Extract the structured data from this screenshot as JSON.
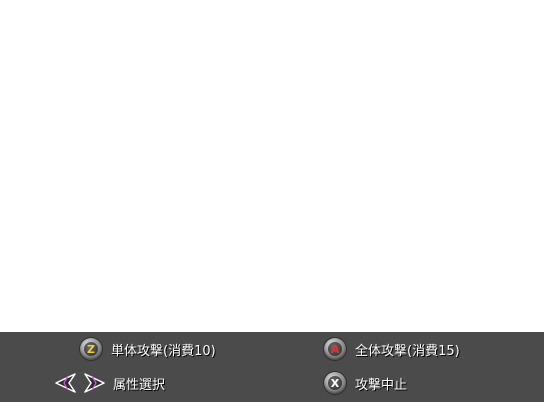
{
  "hints": {
    "single_attack": {
      "key": "Z",
      "key_icon": "z-key-icon",
      "label": "単体攻撃(消費10)",
      "key_color": "#f0c84a"
    },
    "all_attack": {
      "key": "A",
      "key_icon": "a-key-icon",
      "label": "全体攻撃(消費15)",
      "key_color": "#e0342e"
    },
    "attribute_select": {
      "key_icons": [
        "left-arrow-icon",
        "right-arrow-icon"
      ],
      "label": "属性選択",
      "arrow_left_color": "#ffffff",
      "arrow_right_color": "#d060e0"
    },
    "stop_attack": {
      "key": "X",
      "key_icon": "x-key-icon",
      "label": "攻撃中止",
      "key_color": "#ffffff"
    }
  },
  "colors": {
    "bar_background": "#4b4b4b",
    "background": "#ffffff",
    "label_text": "#ffffff"
  }
}
